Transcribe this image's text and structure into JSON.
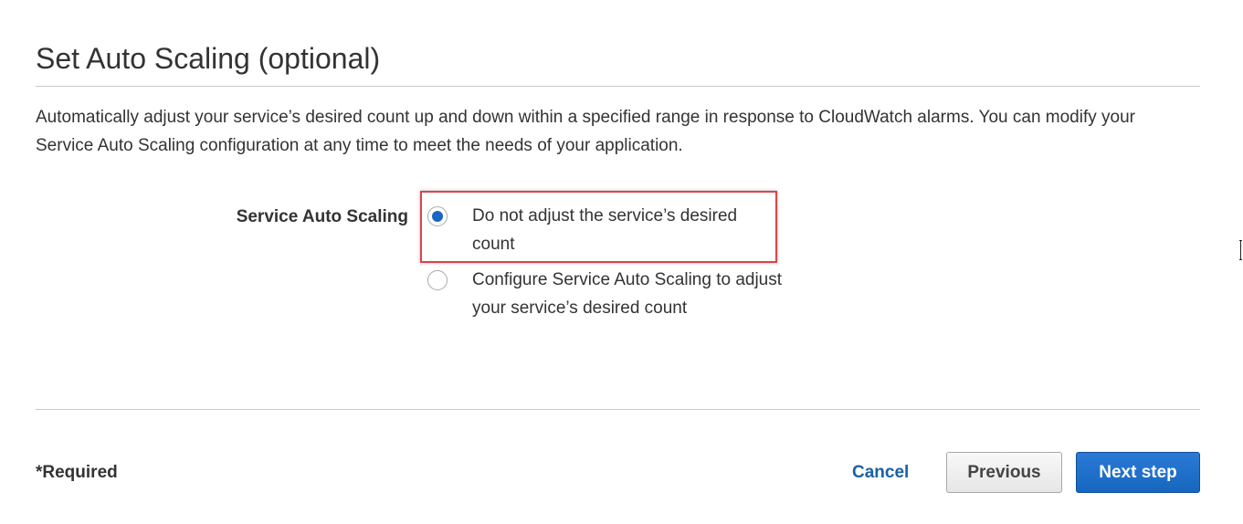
{
  "header": {
    "title": "Set Auto Scaling (optional)"
  },
  "description": "Automatically adjust your service’s desired count up and down within a specified range in response to CloudWatch alarms. You can modify your Service Auto Scaling configuration at any time to meet the needs of your application.",
  "form": {
    "label": "Service Auto Scaling",
    "options": [
      {
        "label": "Do not adjust the service’s desired count",
        "selected": true
      },
      {
        "label": "Configure Service Auto Scaling to adjust your service’s desired count",
        "selected": false
      }
    ]
  },
  "footer": {
    "required_note": "*Required",
    "cancel_label": "Cancel",
    "previous_label": "Previous",
    "next_label": "Next step"
  },
  "colors": {
    "accent": "#1a66c2",
    "link": "#1a5fa8",
    "highlight": "#d9454c"
  }
}
